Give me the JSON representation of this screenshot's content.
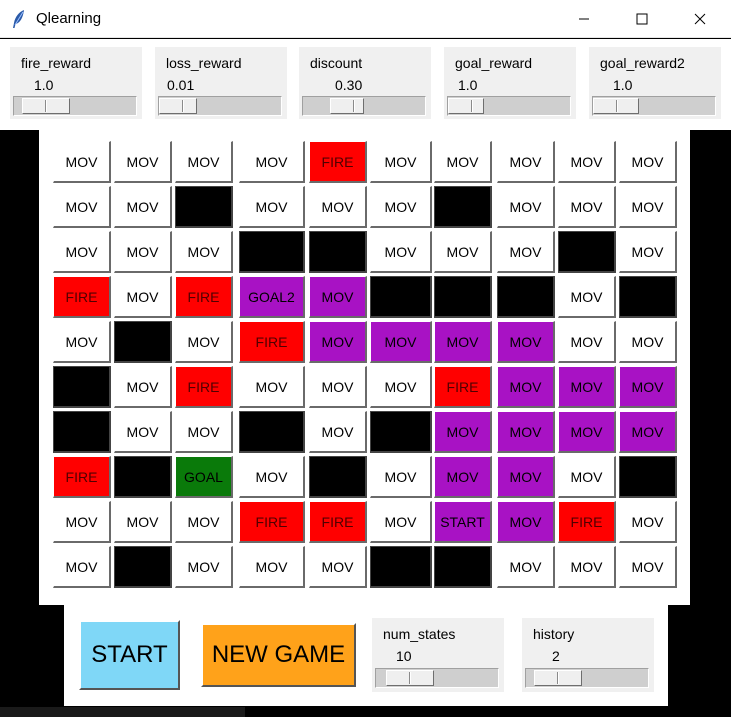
{
  "window": {
    "title": "Qlearning",
    "app_icon": "feather-icon",
    "controls": [
      "minimize-icon",
      "maximize-icon",
      "close-icon"
    ]
  },
  "sliders": [
    {
      "name": "fire_reward",
      "value": "1.0",
      "position": 0.2
    },
    {
      "name": "loss_reward",
      "value": "0.01",
      "position": 0.1
    },
    {
      "name": "discount",
      "value": "0.30",
      "position": 0.3
    },
    {
      "name": "goal_reward",
      "value": "1.0",
      "position": 0.1
    },
    {
      "name": "goal_reward2",
      "value": "1.0",
      "position": 0.1
    }
  ],
  "grid": {
    "labels": {
      "mov": "MOV",
      "fire": "FIRE",
      "wall": "",
      "goal": "GOAL",
      "goal2": "GOAL2",
      "start": "START"
    },
    "colors": {
      "mov": "#ffffff",
      "fire": "#ff0000",
      "wall": "#000000",
      "path": "#a812c4",
      "goal": "#0a7a0a"
    },
    "rows": [
      [
        [
          "MOV",
          "mov"
        ],
        [
          "MOV",
          "mov"
        ],
        [
          "MOV",
          "mov"
        ],
        [
          "MOV",
          "mov"
        ],
        [
          "FIRE",
          "fire"
        ],
        [
          "MOV",
          "mov"
        ],
        [
          "MOV",
          "mov"
        ],
        [
          "MOV",
          "mov"
        ],
        [
          "MOV",
          "mov"
        ],
        [
          "MOV",
          "mov"
        ]
      ],
      [
        [
          "MOV",
          "mov"
        ],
        [
          "MOV",
          "mov"
        ],
        [
          "",
          "wall"
        ],
        [
          "MOV",
          "mov"
        ],
        [
          "MOV",
          "mov"
        ],
        [
          "MOV",
          "mov"
        ],
        [
          "",
          "wall"
        ],
        [
          "MOV",
          "mov"
        ],
        [
          "MOV",
          "mov"
        ],
        [
          "MOV",
          "mov"
        ]
      ],
      [
        [
          "MOV",
          "mov"
        ],
        [
          "MOV",
          "mov"
        ],
        [
          "MOV",
          "mov"
        ],
        [
          "",
          "wall"
        ],
        [
          "",
          "wall"
        ],
        [
          "MOV",
          "mov"
        ],
        [
          "MOV",
          "mov"
        ],
        [
          "MOV",
          "mov"
        ],
        [
          "",
          "wall"
        ],
        [
          "MOV",
          "mov"
        ]
      ],
      [
        [
          "FIRE",
          "fire"
        ],
        [
          "MOV",
          "mov"
        ],
        [
          "FIRE",
          "fire"
        ],
        [
          "GOAL2",
          "path"
        ],
        [
          "MOV",
          "path"
        ],
        [
          "",
          "wall"
        ],
        [
          "",
          "wall"
        ],
        [
          "",
          "wall"
        ],
        [
          "MOV",
          "mov"
        ],
        [
          "",
          "wall"
        ]
      ],
      [
        [
          "MOV",
          "mov"
        ],
        [
          "",
          "wall"
        ],
        [
          "MOV",
          "mov"
        ],
        [
          "FIRE",
          "fire"
        ],
        [
          "MOV",
          "path"
        ],
        [
          "MOV",
          "path"
        ],
        [
          "MOV",
          "path"
        ],
        [
          "MOV",
          "path"
        ],
        [
          "MOV",
          "mov"
        ],
        [
          "MOV",
          "mov"
        ]
      ],
      [
        [
          "",
          "wall"
        ],
        [
          "MOV",
          "mov"
        ],
        [
          "FIRE",
          "fire"
        ],
        [
          "MOV",
          "mov"
        ],
        [
          "MOV",
          "mov"
        ],
        [
          "MOV",
          "mov"
        ],
        [
          "FIRE",
          "fire"
        ],
        [
          "MOV",
          "path"
        ],
        [
          "MOV",
          "path"
        ],
        [
          "MOV",
          "path"
        ]
      ],
      [
        [
          "",
          "wall"
        ],
        [
          "MOV",
          "mov"
        ],
        [
          "MOV",
          "mov"
        ],
        [
          "",
          "wall"
        ],
        [
          "MOV",
          "mov"
        ],
        [
          "",
          "wall"
        ],
        [
          "MOV",
          "path"
        ],
        [
          "MOV",
          "path"
        ],
        [
          "MOV",
          "path"
        ],
        [
          "MOV",
          "path"
        ]
      ],
      [
        [
          "FIRE",
          "fire"
        ],
        [
          "",
          "wall"
        ],
        [
          "GOAL",
          "goal"
        ],
        [
          "MOV",
          "mov"
        ],
        [
          "",
          "wall"
        ],
        [
          "MOV",
          "mov"
        ],
        [
          "MOV",
          "path"
        ],
        [
          "MOV",
          "path"
        ],
        [
          "MOV",
          "mov"
        ],
        [
          "",
          "wall"
        ]
      ],
      [
        [
          "MOV",
          "mov"
        ],
        [
          "MOV",
          "mov"
        ],
        [
          "MOV",
          "mov"
        ],
        [
          "FIRE",
          "fire"
        ],
        [
          "FIRE",
          "fire"
        ],
        [
          "MOV",
          "mov"
        ],
        [
          "START",
          "path"
        ],
        [
          "MOV",
          "path"
        ],
        [
          "FIRE",
          "fire"
        ],
        [
          "MOV",
          "mov"
        ]
      ],
      [
        [
          "MOV",
          "mov"
        ],
        [
          "",
          "wall"
        ],
        [
          "MOV",
          "mov"
        ],
        [
          "MOV",
          "mov"
        ],
        [
          "MOV",
          "mov"
        ],
        [
          "",
          "wall"
        ],
        [
          "",
          "wall"
        ],
        [
          "MOV",
          "mov"
        ],
        [
          "MOV",
          "mov"
        ],
        [
          "MOV",
          "mov"
        ]
      ]
    ]
  },
  "controls": {
    "start_label": "START",
    "start_color": "#7fd7f7",
    "new_game_label": "NEW GAME",
    "new_game_color": "#ffa21a",
    "num_states": {
      "name": "num_states",
      "value": "10",
      "position": 0.1
    },
    "history": {
      "name": "history",
      "value": "2",
      "position": 0.1
    }
  }
}
